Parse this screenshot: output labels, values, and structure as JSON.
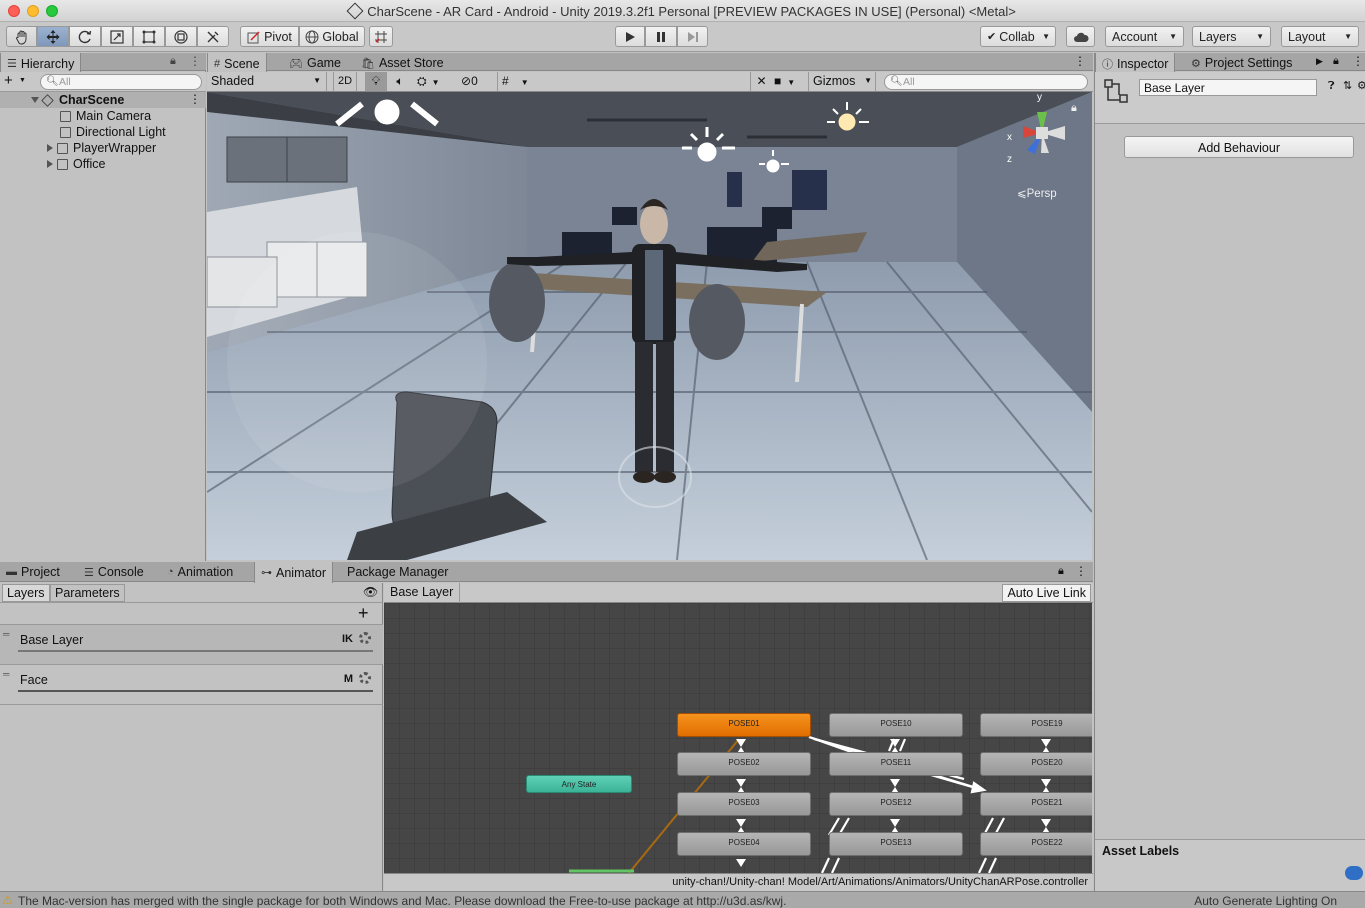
{
  "window": {
    "title": "CharScene - AR Card - Android - Unity 2019.3.2f1 Personal [PREVIEW PACKAGES IN USE] (Personal) <Metal>"
  },
  "toolbar": {
    "pivot_label": "Pivot",
    "global_label": "Global",
    "collab_label": "Collab",
    "account_label": "Account",
    "layers_label": "Layers",
    "layout_label": "Layout"
  },
  "hierarchy": {
    "tab_label": "Hierarchy",
    "search_placeholder": "All",
    "scene_name": "CharScene",
    "items": [
      {
        "label": "Main Camera"
      },
      {
        "label": "Directional Light"
      },
      {
        "label": "PlayerWrapper"
      },
      {
        "label": "Office"
      }
    ]
  },
  "scene_tabs": {
    "scene": "Scene",
    "game": "Game",
    "asset_store": "Asset Store"
  },
  "scene_toolbar": {
    "shading_mode": "Shaded",
    "two_d": "2D",
    "hidden_count": "0",
    "gizmos": "Gizmos",
    "search_placeholder": "All",
    "persp_label": "Persp",
    "axis_y": "y",
    "axis_x": "x",
    "axis_z": "z"
  },
  "inspector": {
    "tab_label": "Inspector",
    "project_settings_tab": "Project Settings",
    "object_name": "Base Layer",
    "add_behaviour": "Add Behaviour",
    "asset_labels": "Asset Labels"
  },
  "bottom_tabs": {
    "project": "Project",
    "console": "Console",
    "animation": "Animation",
    "animator": "Animator",
    "package_manager": "Package Manager"
  },
  "animator": {
    "layers_tab": "Layers",
    "parameters_tab": "Parameters",
    "breadcrumb": "Base Layer",
    "auto_live_link": "Auto Live Link",
    "layers": [
      {
        "name": "Base Layer",
        "tag": "IK"
      },
      {
        "name": "Face",
        "tag": "M"
      }
    ],
    "any_state": "Any State",
    "states": {
      "col1": [
        "POSE01",
        "POSE02",
        "POSE03",
        "POSE04"
      ],
      "col2": [
        "POSE10",
        "POSE11",
        "POSE12",
        "POSE13"
      ],
      "col3": [
        "POSE19",
        "POSE20",
        "POSE21",
        "POSE22"
      ]
    },
    "controller_path": "unity-chan!/Unity-chan! Model/Art/Animations/Animators/UnityChanARPose.controller"
  },
  "status_bar": {
    "message": "The Mac-version has merged with the single package for both Windows and Mac. Please download the Free-to-use package at http://u3d.as/kwj.",
    "right_text": "Auto Generate Lighting On"
  },
  "colors": {
    "default_state": "#f08a1a",
    "any_state": "#4cc2a6",
    "panel_bg": "#c2c2c2",
    "graph_bg": "#464646"
  }
}
